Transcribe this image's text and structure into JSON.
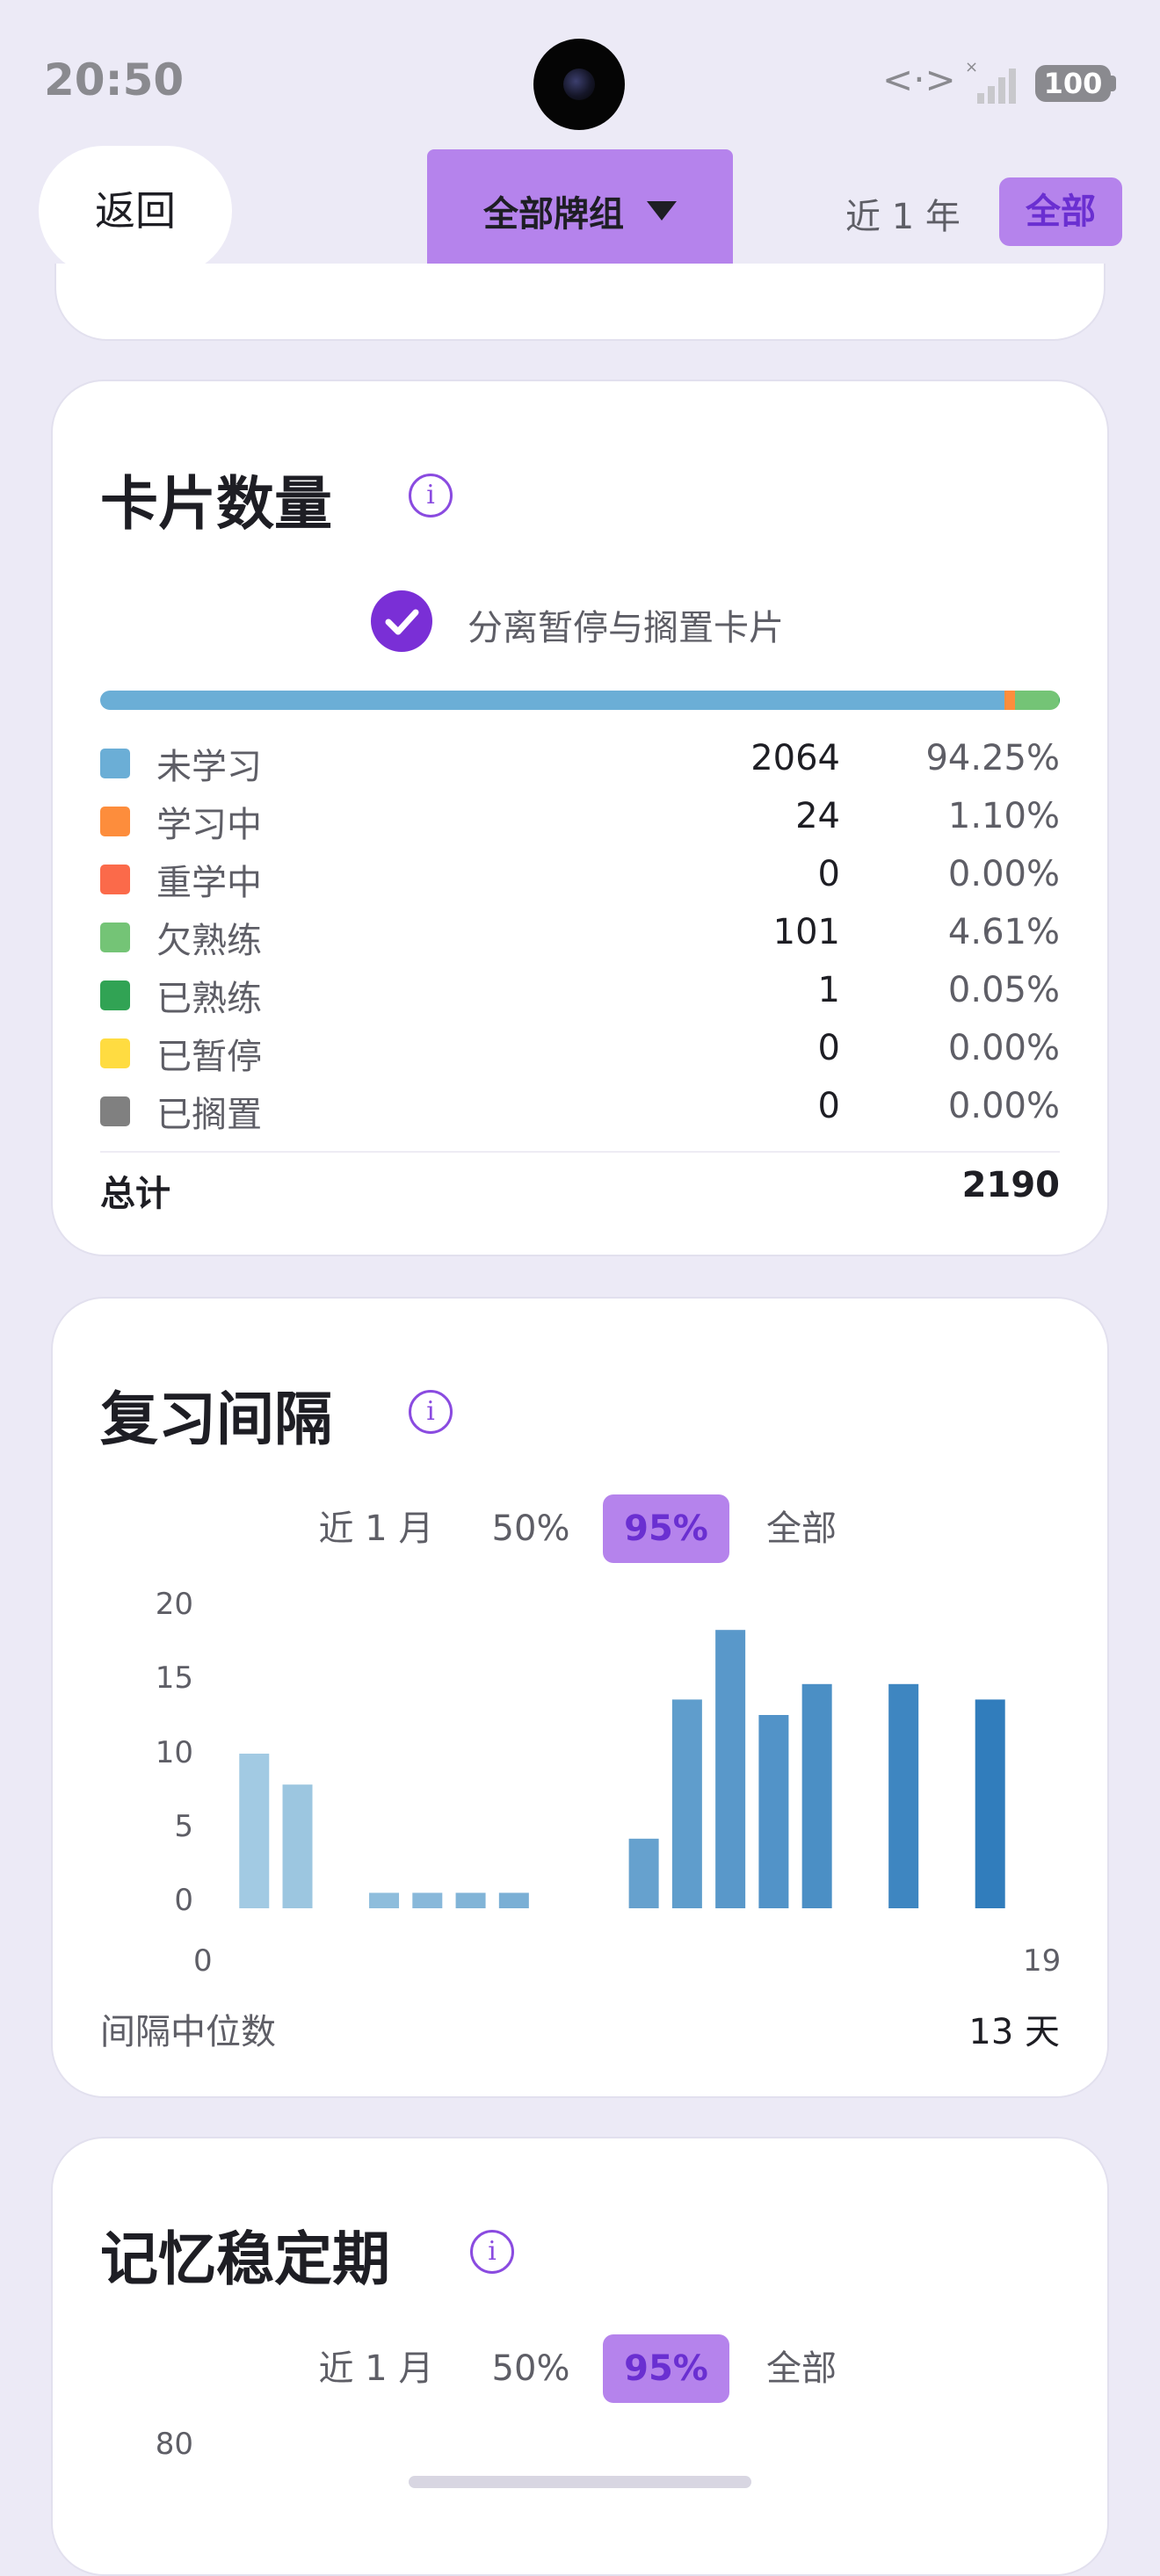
{
  "status_bar": {
    "time": "20:50",
    "battery": "100",
    "data_icon": "data-transfer-icon",
    "signal_icon": "signal-bars-icon"
  },
  "header": {
    "back_label": "返回",
    "deck_selector_label": "全部牌组",
    "range_options": [
      "近 1 年",
      "全部"
    ],
    "range_selected": "全部"
  },
  "colors": {
    "accent": "#B583EC",
    "accent_text": "#6A2FD1",
    "check": "#7A2FD6"
  },
  "card_count": {
    "title": "卡片数量",
    "toggle_label": "分离暂停与搁置卡片",
    "toggle_checked": true,
    "rows": [
      {
        "label": "未学习",
        "count": "2064",
        "percent": "94.25%",
        "color": "#6BAED6"
      },
      {
        "label": "学习中",
        "count": "24",
        "percent": "1.10%",
        "color": "#FD8D3C"
      },
      {
        "label": "重学中",
        "count": "0",
        "percent": "0.00%",
        "color": "#FB6A4A"
      },
      {
        "label": "欠熟练",
        "count": "101",
        "percent": "4.61%",
        "color": "#74C476"
      },
      {
        "label": "已熟练",
        "count": "1",
        "percent": "0.05%",
        "color": "#31A354"
      },
      {
        "label": "已暂停",
        "count": "0",
        "percent": "0.00%",
        "color": "#FFDC41"
      },
      {
        "label": "已搁置",
        "count": "0",
        "percent": "0.00%",
        "color": "#808080"
      }
    ],
    "total_label": "总计",
    "total_value": "2190"
  },
  "review_interval": {
    "title": "复习间隔",
    "filters": [
      "近 1 月",
      "50%",
      "95%",
      "全部"
    ],
    "active_filter": "95%",
    "median_label": "间隔中位数",
    "median_value": "13 天"
  },
  "stability": {
    "title": "记忆稳定期",
    "filters": [
      "近 1 月",
      "50%",
      "95%",
      "全部"
    ],
    "active_filter": "95%",
    "y_top_label": "80"
  },
  "chart_data": {
    "type": "bar",
    "title": "复习间隔",
    "xlabel": "",
    "ylabel": "",
    "x_tick_labels": [
      "0",
      "19"
    ],
    "y_tick_labels": [
      "20",
      "15",
      "10",
      "5",
      "0"
    ],
    "ylim": [
      0,
      20
    ],
    "x": [
      1,
      2,
      4,
      5,
      6,
      7,
      10,
      11,
      12,
      13,
      14,
      16,
      18
    ],
    "values": [
      10,
      8,
      1,
      1,
      1,
      1,
      4.5,
      13.5,
      18,
      12.5,
      14.5,
      14.5,
      13.5
    ],
    "color_scale": [
      "#A9CFE5",
      "#2A78BA"
    ],
    "grid": false
  }
}
